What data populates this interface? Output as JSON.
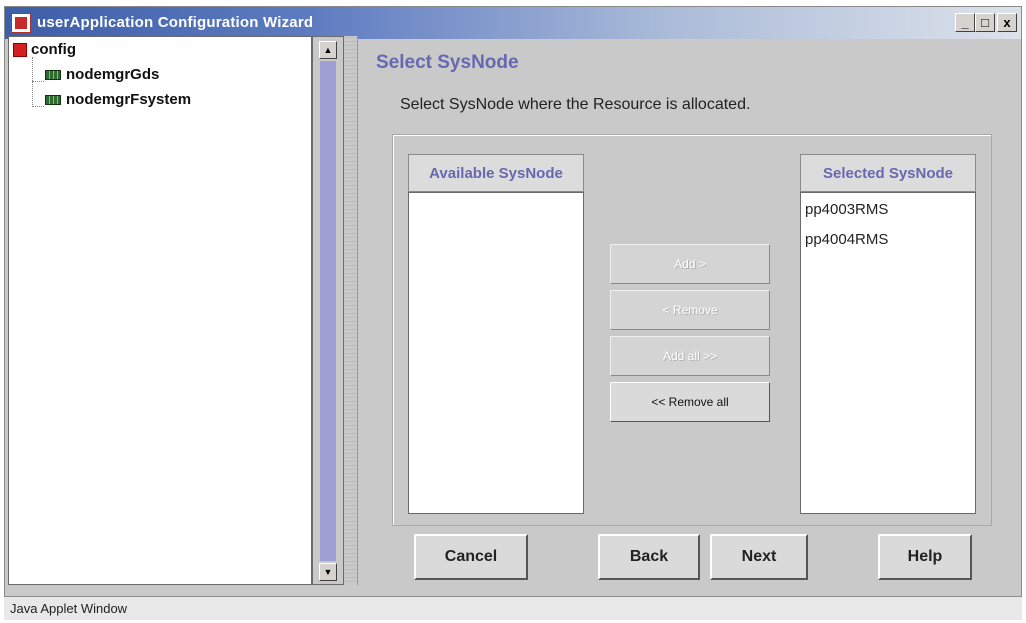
{
  "window": {
    "title": "userApplication Configuration Wizard",
    "controls": {
      "minimize": "_",
      "maximize": "□",
      "close": "x"
    }
  },
  "tree": {
    "root": "config",
    "children": [
      "nodemgrGds",
      "nodemgrFsystem"
    ]
  },
  "main": {
    "title": "Select SysNode",
    "description": "Select SysNode where the Resource is allocated.",
    "available": {
      "header": "Available SysNode",
      "items": []
    },
    "selected": {
      "header": "Selected SysNode",
      "items": [
        "pp4003RMS",
        "pp4004RMS"
      ]
    },
    "buttons": {
      "add": "Add >",
      "remove": "< Remove",
      "add_all": "Add all >>",
      "remove_all": "<< Remove all"
    }
  },
  "footer": {
    "cancel": "Cancel",
    "back": "Back",
    "next": "Next",
    "help": "Help"
  },
  "status": "Java Applet Window"
}
